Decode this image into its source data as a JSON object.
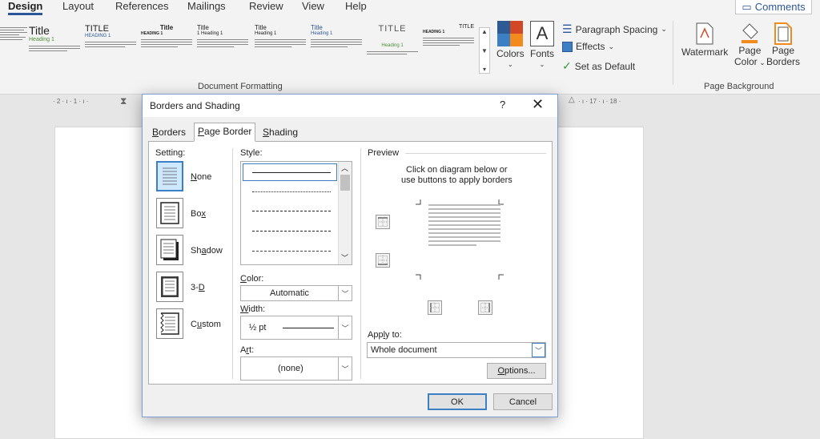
{
  "ribbon_tabs": [
    "Design",
    "Layout",
    "References",
    "Mailings",
    "Review",
    "View",
    "Help"
  ],
  "active_tab": "Design",
  "comments_label": "Comments",
  "gallery": {
    "items": [
      {
        "title": "",
        "heading": ""
      },
      {
        "title": "Title",
        "heading": "Heading 1"
      },
      {
        "title": "TITLE",
        "heading": "HEADING 1"
      },
      {
        "title": "Title",
        "heading": "HEADING 1"
      },
      {
        "title": "Title",
        "heading": "1 Heading 1"
      },
      {
        "title": "Title",
        "heading": "Heading 1"
      },
      {
        "title": "Title",
        "heading": "Heading 1"
      },
      {
        "title": "TITLE",
        "heading": "Heading 1"
      },
      {
        "title": "TITLE",
        "heading": "HEADING 1"
      }
    ],
    "group_label": "Document Formatting"
  },
  "colors_label": "Colors",
  "fonts_label": "Fonts",
  "paragraph_spacing_label": "Paragraph Spacing",
  "effects_label": "Effects",
  "set_default_label": "Set as Default",
  "page_background": {
    "watermark_label": "Watermark",
    "page_color_label_1": "Page",
    "page_color_label_2": "Color",
    "page_borders_label_1": "Page",
    "page_borders_label_2": "Borders",
    "group_label": "Page Background"
  },
  "ruler_left": "· 2 · ı · 1 · ı ·",
  "ruler_right": "· ı · 17 · ı · 18 ·",
  "dialog": {
    "title": "Borders and Shading",
    "help": "?",
    "close": "✕",
    "tabs": [
      {
        "label": "Borders",
        "key": "B",
        "rest": "orders"
      },
      {
        "label": "Page Border",
        "key": "P",
        "rest": "age Border"
      },
      {
        "label": "Shading",
        "key": "S",
        "rest": "hading"
      }
    ],
    "setting_label": "Setting:",
    "settings": [
      {
        "label": "None",
        "key": "N",
        "rest": "one"
      },
      {
        "label": "Box",
        "pre": "Bo",
        "key": "x",
        "rest": ""
      },
      {
        "label": "Shadow",
        "pre": "Sh",
        "key": "a",
        "rest": "dow"
      },
      {
        "label": "3-D",
        "pre": "3-",
        "key": "D",
        "rest": ""
      },
      {
        "label": "Custom",
        "pre": "C",
        "key": "u",
        "rest": "stom"
      }
    ],
    "style_label": "Style:",
    "color_label": "Color:",
    "color_value": "Automatic",
    "width_label": "Width:",
    "width_value": "½ pt",
    "art_label": "Art:",
    "art_value": "(none)",
    "preview_label": "Preview",
    "preview_hint_1": "Click on diagram below or",
    "preview_hint_2": "use buttons to apply borders",
    "apply_to_label": "Apply to:",
    "apply_to_value": "Whole document",
    "options_label": "Options...",
    "ok_label": "OK",
    "cancel_label": "Cancel"
  }
}
